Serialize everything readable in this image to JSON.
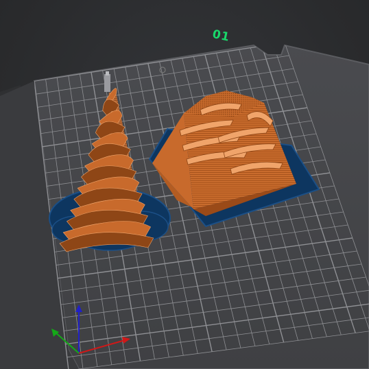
{
  "scene": {
    "plate_label": "01",
    "colors": {
      "background": "#2b2c2e",
      "bed": "#46474a",
      "bed_edge": "#5b5c60",
      "grid": "#8f9094",
      "filament": "#c86a2c",
      "filament_shadow": "#8e4616",
      "filament_highlight": "#f0a46a",
      "brim": "#0d3660",
      "brim_edge": "#1b4f86",
      "plate_label": "#19d86a",
      "axis_x": "#d01818",
      "axis_y": "#14a818",
      "axis_z": "#2020c8"
    },
    "objects": [
      {
        "name": "twisted-spiral-cone",
        "material": "filament"
      },
      {
        "name": "twisted-square-pyramid",
        "material": "filament"
      }
    ],
    "axes": [
      "x-axis",
      "y-axis",
      "z-axis"
    ]
  }
}
